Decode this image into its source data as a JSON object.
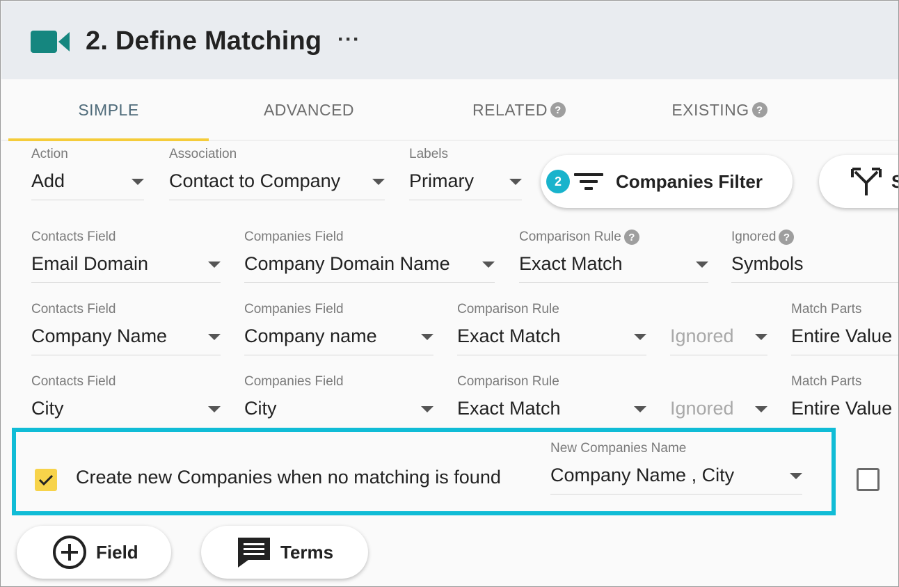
{
  "header": {
    "title": "2. Define Matching",
    "more": "···"
  },
  "tabs": [
    {
      "label": "SIMPLE"
    },
    {
      "label": "ADVANCED"
    },
    {
      "label": "RELATED",
      "help": "?"
    },
    {
      "label": "EXISTING",
      "help": "?"
    }
  ],
  "top_row": {
    "action": {
      "label": "Action",
      "value": "Add"
    },
    "association": {
      "label": "Association",
      "value": "Contact to Company"
    },
    "labels": {
      "label": "Labels",
      "value": "Primary"
    },
    "filter_button": {
      "badge": "2",
      "label": "Companies Filter"
    },
    "split_button": {
      "label": "S"
    }
  },
  "rows": [
    {
      "contacts_field": {
        "label": "Contacts Field",
        "value": "Email Domain"
      },
      "companies_field": {
        "label": "Companies Field",
        "value": "Company Domain Name"
      },
      "comparison_rule": {
        "label": "Comparison Rule",
        "help": "?",
        "value": "Exact Match"
      },
      "ignored": {
        "label": "Ignored",
        "help": "?",
        "value": "Symbols"
      }
    },
    {
      "contacts_field": {
        "label": "Contacts Field",
        "value": "Company Name"
      },
      "companies_field": {
        "label": "Companies Field",
        "value": "Company name"
      },
      "comparison_rule": {
        "label": "Comparison Rule",
        "value": "Exact Match"
      },
      "ignored": {
        "value": "Ignored"
      },
      "match_parts": {
        "label": "Match Parts",
        "value": "Entire Value"
      }
    },
    {
      "contacts_field": {
        "label": "Contacts Field",
        "value": "City"
      },
      "companies_field": {
        "label": "Companies Field",
        "value": "City"
      },
      "comparison_rule": {
        "label": "Comparison Rule",
        "value": "Exact Match"
      },
      "ignored": {
        "value": "Ignored"
      },
      "match_parts": {
        "label": "Match Parts",
        "value": "Entire Value"
      }
    }
  ],
  "create_new": {
    "checked": true,
    "label": "Create new Companies when no matching is found",
    "name_field": {
      "label": "New Companies Name",
      "value": "Company Name , City"
    }
  },
  "bottom_buttons": {
    "field": "Field",
    "terms": "Terms"
  },
  "colors": {
    "accent_teal": "#10bcd6",
    "tab_underline": "#f5cc3a",
    "checkbox": "#f7d34a",
    "icon_teal": "#15867f"
  }
}
